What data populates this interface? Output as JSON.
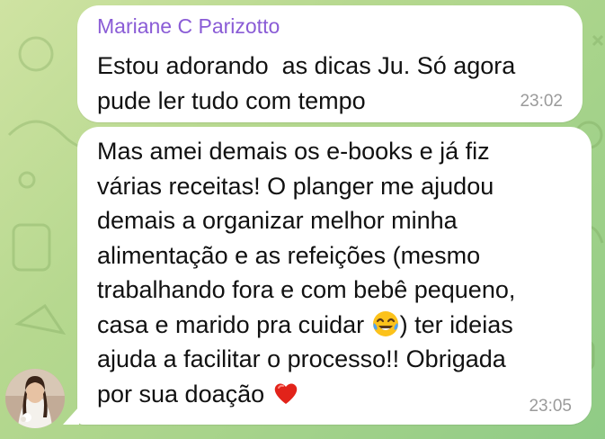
{
  "messages": [
    {
      "sender": "Mariane C Parizotto",
      "text_lines": [
        "Estou adorando  as dicas Ju. Só agora",
        "pude ler tudo com tempo"
      ],
      "time": "23:02"
    },
    {
      "text_lines": [
        "Mas amei demais os e-books e já fiz",
        "várias receitas! O planger me ajudou",
        "demais a organizar melhor minha",
        "alimentação e as refeições (mesmo",
        "trabalhando fora e com bebê pequeno,",
        "casa e marido pra cuidar ",
        ") ter ideias",
        "ajuda a facilitar o processo!! Obrigada",
        "por sua doação "
      ],
      "time": "23:05",
      "emojis": [
        "tears-of-joy-emoji",
        "red-heart-emoji"
      ]
    }
  ],
  "colors": {
    "sender_name": "#8a5cd6",
    "bubble": "#ffffff",
    "timestamp": "#9a9a9a",
    "wallpaper_start": "#cfe3a2",
    "wallpaper_end": "#8fcb86"
  }
}
